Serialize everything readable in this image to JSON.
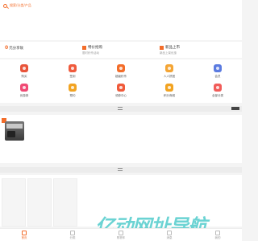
{
  "search": {
    "text": "搜索/分类/产品"
  },
  "promos": [
    {
      "price": "0",
      "title": "元分享砍",
      "sub": ""
    },
    {
      "price": "",
      "title": "特价抢购",
      "sub": "限时秒杀活动"
    },
    {
      "price": "",
      "title": "新品上市",
      "sub": "新品上架优惠"
    }
  ],
  "nav": [
    {
      "label": "购买",
      "icon": "cart-icon",
      "color": "#e8543a"
    },
    {
      "label": "签到",
      "icon": "gift-icon",
      "color": "#ef5a3c"
    },
    {
      "label": "超级秒杀",
      "icon": "flash-icon",
      "color": "#f36d2a"
    },
    {
      "label": "人人拼团",
      "icon": "group-icon",
      "color": "#f4a535"
    },
    {
      "label": "会员",
      "icon": "gem-icon",
      "color": "#5b7be0"
    },
    {
      "label": "优惠券",
      "icon": "coupon-icon",
      "color": "#f04a74"
    },
    {
      "label": "预约",
      "icon": "bell-icon",
      "color": "#f2a321"
    },
    {
      "label": "领券中心",
      "icon": "ticket-icon",
      "color": "#f05a3a"
    },
    {
      "label": "积分商城",
      "icon": "points-icon",
      "color": "#f2a321"
    },
    {
      "label": "全部分类",
      "icon": "menu-icon",
      "color": "#f15c59"
    }
  ],
  "product": {
    "price": ""
  },
  "tabs": [
    {
      "label": "首页",
      "active": true
    },
    {
      "label": "分类",
      "active": false
    },
    {
      "label": "购物车",
      "active": false
    },
    {
      "label": "消息",
      "active": false
    },
    {
      "label": "我的",
      "active": false
    }
  ],
  "watermark": "亿动网址导航"
}
